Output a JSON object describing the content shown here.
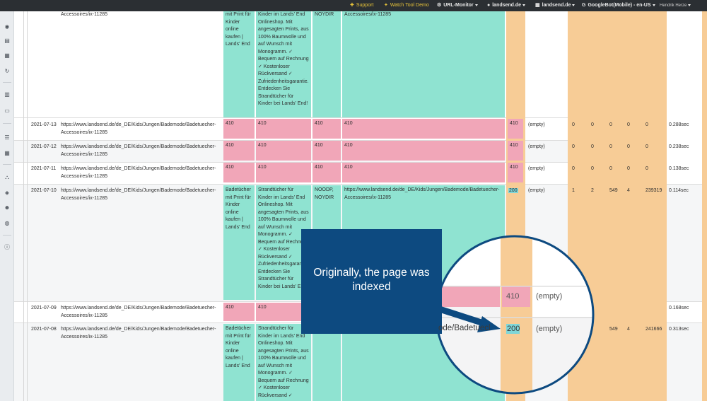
{
  "topbar": {
    "support": "Support",
    "demo": "Watch Tool Demo",
    "monitor": "URL-Monitor",
    "domain": "landsend.de",
    "project": "landsend.de",
    "bot": "GoogleBot(Mobile) - en-US",
    "user": "Hendrik Herze"
  },
  "sidebar_icons": [
    "puzzle-icon",
    "calendar-list-icon",
    "calendar-icon",
    "refresh-icon",
    "bar-chart-icon",
    "keyboard-icon",
    "list-icon",
    "table-icon",
    "network-icon",
    "cube-icon",
    "users-icon",
    "globe-icon",
    "info-icon"
  ],
  "rows": [
    {
      "date": "",
      "url": "Accessoires/ix-11285",
      "title": "mit Print für Kinder online kaufen | Lands' End",
      "desc": "Kinder im Lands' End Onlineshop. Mit angesagten Prints, aus 100% Baumwolle und auf Wunsch mit Monogramm. ✓ Bequem auf Rechnung ✓ Kostenloser Rückversand ✓ Zufriedenheitsgarantie. Entdecken Sie Strandtücher für Kinder bei Lands' End!",
      "robots": "NOYDIR",
      "canonical": "Accessoires/ix-11285",
      "status": "",
      "redirect": "",
      "n1": "",
      "n2": "",
      "n3": "",
      "n4": "",
      "n5": "",
      "time": ""
    },
    {
      "date": "2021-07-13",
      "url": "https://www.landsend.de/de_DE/Kids/Jungen/Bademode/Badetuecher-Accessoires/ix-11285",
      "title": "410",
      "desc": "410",
      "robots": "410",
      "canonical": "410",
      "status": "410",
      "redirect": "(empty)",
      "n1": "0",
      "n2": "0",
      "n3": "0",
      "n4": "0",
      "n5": "0",
      "time": "0.288sec"
    },
    {
      "date": "2021-07-12",
      "url": "https://www.landsend.de/de_DE/Kids/Jungen/Bademode/Badetuecher-Accessoires/ix-11285",
      "title": "410",
      "desc": "410",
      "robots": "410",
      "canonical": "410",
      "status": "410",
      "redirect": "(empty)",
      "n1": "0",
      "n2": "0",
      "n3": "0",
      "n4": "0",
      "n5": "0",
      "time": "0.238sec"
    },
    {
      "date": "2021-07-11",
      "url": "https://www.landsend.de/de_DE/Kids/Jungen/Bademode/Badetuecher-Accessoires/ix-11285",
      "title": "410",
      "desc": "410",
      "robots": "410",
      "canonical": "410",
      "status": "410",
      "redirect": "(empty)",
      "n1": "0",
      "n2": "0",
      "n3": "0",
      "n4": "0",
      "n5": "0",
      "time": "0.138sec"
    },
    {
      "date": "2021-07-10",
      "url": "https://www.landsend.de/de_DE/Kids/Jungen/Bademode/Badetuecher-Accessoires/ix-11285",
      "title": "Badetücher mit Print für Kinder online kaufen | Lands' End",
      "desc": "Strandtücher für Kinder im Lands' End Onlineshop. Mit angesagten Prints, aus 100% Baumwolle und auf Wunsch mit Monogramm. ✓ Bequem auf Rechnung ✓ Kostenloser Rückversand ✓ Zufriedenheitsgarantie. Entdecken Sie Strandtücher für Kinder bei Lands' End!",
      "robots": "NOODP, NOYDIR",
      "canonical": "https://www.landsend.de/de_DE/Kids/Jungen/Bademode/Badetuecher-Accessoires/ix-11285",
      "status": "200",
      "redirect": "(empty)",
      "n1": "1",
      "n2": "2",
      "n3": "549",
      "n4": "4",
      "n5": "239319",
      "time": "0.114sec"
    },
    {
      "date": "2021-07-09",
      "url": "https://www.landsend.de/de_DE/Kids/Jungen/Bademode/Badetuecher-Accessoires/ix-11285",
      "title": "410",
      "desc": "410",
      "robots": "",
      "canonical": "",
      "status": "",
      "redirect": "",
      "n1": "",
      "n2": "",
      "n3": "",
      "n4": "",
      "n5": "",
      "time": "0.168sec"
    },
    {
      "date": "2021-07-08",
      "url": "https://www.landsend.de/de_DE/Kids/Jungen/Bademode/Badetuecher-Accessoires/ix-11285",
      "title": "Badetücher mit Print für Kinder online kaufen | Lands' End",
      "desc": "Strandtücher für Kinder im Lands' End Onlineshop. Mit angesagten Prints, aus 100% Baumwolle und auf Wunsch mit Monogramm. ✓ Bequem auf Rechnung ✓ Kostenloser Rückversand ✓",
      "robots": "NOYDIR",
      "canonical": "Accessoires/ix-11285",
      "status": "",
      "redirect": "",
      "n1": "",
      "n2": "",
      "n3": "549",
      "n4": "4",
      "n5": "241666",
      "time": "0.313sec"
    }
  ],
  "callout": {
    "text": "Originally, the page was indexed"
  },
  "zoom": {
    "url_fragment": "ode/Badetuecl",
    "status_410": "410",
    "empty_410": "(empty)",
    "status_200": "200",
    "empty_200": "(empty)"
  },
  "colors": {
    "ok": "#8fe3d1",
    "error": "#f1a6b8",
    "status_col": "#f7cc96",
    "callout": "#0d4a80"
  }
}
